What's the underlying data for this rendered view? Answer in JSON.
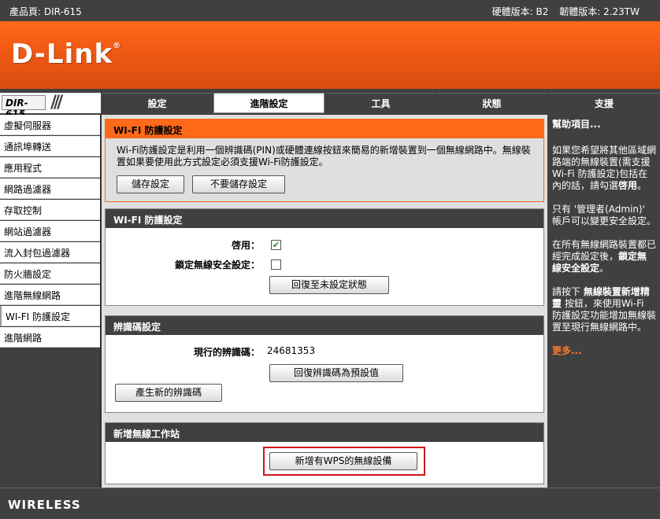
{
  "topbar": {
    "product": "產品頁: DIR-615",
    "hardware": "硬體版本: B2",
    "firmware": "韌體版本: 2.23TW"
  },
  "brand": {
    "logo": "D-Link",
    "reg": "®"
  },
  "model": "DIR-615",
  "nav": {
    "tabs": [
      "設定",
      "進階設定",
      "工具",
      "狀態"
    ],
    "support": "支援"
  },
  "sidebar": {
    "items": [
      "虛擬伺服器",
      "通訊埠轉送",
      "應用程式",
      "網路過濾器",
      "存取控制",
      "網站過濾器",
      "流入封包過濾器",
      "防火牆設定",
      "進階無線網路",
      "WI-FI 防護設定",
      "進階網路"
    ]
  },
  "sec1": {
    "title": "WI-FI 防護設定",
    "desc": "Wi-Fi防護設定是利用一個辨識碼(PIN)或硬體連線按鈕來簡易的新增裝置到一個無線網路中。無線裝置如果要使用此方式設定必須支援Wi-Fi防護設定。",
    "save": "儲存設定",
    "nosave": "不要儲存設定"
  },
  "sec2": {
    "title": "WI-FI 防護設定",
    "enable_label": "啓用：",
    "lock_label": "鎖定無線安全設定：",
    "reset_btn": "回復至未設定狀態",
    "enable_checked": true,
    "lock_checked": false
  },
  "sec3": {
    "title": "辨識碼設定",
    "pin_label": "現行的辨識碼：",
    "pin_value": "24681353",
    "restore_btn": "回復辨識碼為預設值",
    "gen_btn": "產生新的辨識碼"
  },
  "sec4": {
    "title": "新增無線工作站",
    "add_btn": "新增有WPS的無線設備"
  },
  "help": {
    "title": "幫助項目...",
    "p1a": "如果您希望將其他區域網路端的無線裝置(需支援Wi-Fi 防護設定)包括在內的話，請勾選",
    "p1b": "啓用",
    "p1c": "。",
    "p2": "只有 '管理者(Admin)' 帳戶可以變更安全設定。",
    "p3a": "在所有無線網路裝置都已經完成設定後，",
    "p3b": "鎖定無線安全設定",
    "p3c": "。",
    "p4a": "請按下 ",
    "p4b": "無線裝置新增精靈",
    "p4c": " 按鈕，來使用Wi-Fi 防護設定功能增加無線裝置至現行無線網路中。",
    "more": "更多..."
  },
  "footer": {
    "brand": "WIRELESS"
  }
}
